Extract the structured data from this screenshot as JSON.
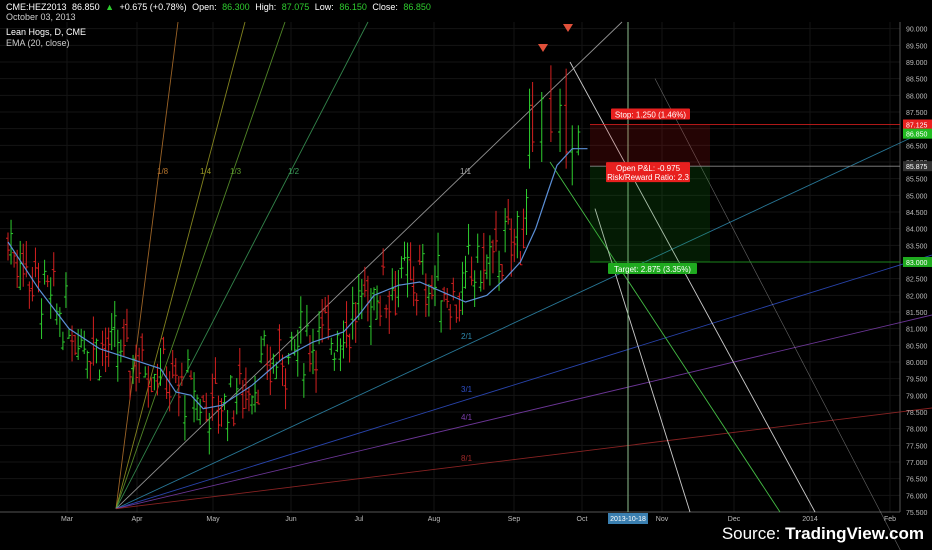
{
  "header": {
    "symbol": "CME:HEZ2013",
    "last": "86.850",
    "change": "+0.675 (+0.78%)",
    "open_label": "Open:",
    "open": "86.300",
    "high_label": "High:",
    "high": "87.075",
    "low_label": "Low:",
    "low": "86.150",
    "close_label": "Close:",
    "close": "86.850",
    "date": "October 03, 2013",
    "instrument": "Lean Hogs, D, CME",
    "indicator": "EMA (20, close)"
  },
  "source": {
    "prefix": "Source: ",
    "brand": "TradingView.com"
  },
  "colors": {
    "up": "#2ecc2e",
    "down": "#d42020",
    "ema": "#5b8fd6",
    "grid": "#141414",
    "stop": "#e8201f",
    "target": "#1faa1f",
    "crosshair": "#8fbf8f"
  },
  "chart_data": {
    "type": "candlestick",
    "y_axis": {
      "ylim": [
        75.5,
        90.2
      ],
      "ticks": [
        "75.500",
        "76.000",
        "76.500",
        "77.000",
        "77.500",
        "78.000",
        "78.500",
        "79.000",
        "79.500",
        "80.000",
        "80.500",
        "81.000",
        "81.500",
        "82.000",
        "82.500",
        "83.000",
        "83.500",
        "84.000",
        "84.500",
        "85.000",
        "85.500",
        "86.000",
        "86.500",
        "87.000",
        "87.500",
        "88.000",
        "88.500",
        "89.000",
        "89.500",
        "90.000"
      ],
      "highlight_labels": [
        {
          "text": "87.125",
          "value": 87.125,
          "color": "#e8201f"
        },
        {
          "text": "86.850",
          "value": 86.85,
          "color": "#22bb22"
        },
        {
          "text": "85.875",
          "value": 85.875,
          "color": "#333333"
        },
        {
          "text": "83.000",
          "value": 83.0,
          "color": "#1faa1f"
        }
      ]
    },
    "x_axis": {
      "labels": [
        "Mar",
        "Apr",
        "May",
        "Jun",
        "Jul",
        "Aug",
        "Sep",
        "Oct",
        "Nov",
        "Dec",
        "2014",
        "Feb"
      ],
      "cursor_label": "2013-10-18"
    },
    "fan_labels": [
      "1/8",
      "1/4",
      "1/3",
      "1/2",
      "1/1",
      "2/1",
      "3/1",
      "4/1",
      "8/1"
    ],
    "ema_points": [
      [
        0,
        83.6
      ],
      [
        10,
        82.2
      ],
      [
        20,
        81.0
      ],
      [
        30,
        80.4
      ],
      [
        40,
        80.1
      ],
      [
        50,
        79.8
      ],
      [
        55,
        79.1
      ],
      [
        60,
        79.0
      ],
      [
        64,
        78.6
      ],
      [
        70,
        78.7
      ],
      [
        80,
        79.3
      ],
      [
        90,
        80.1
      ],
      [
        100,
        80.6
      ],
      [
        110,
        80.9
      ],
      [
        115,
        81.4
      ],
      [
        120,
        82.0
      ],
      [
        128,
        82.3
      ],
      [
        135,
        82.4
      ],
      [
        140,
        82.2
      ],
      [
        145,
        82.0
      ],
      [
        150,
        81.8
      ],
      [
        157,
        82.0
      ],
      [
        163,
        82.5
      ],
      [
        168,
        83.0
      ],
      [
        173,
        84.0
      ],
      [
        177,
        85.1
      ],
      [
        180,
        85.9
      ],
      [
        185,
        86.4
      ],
      [
        190,
        86.4
      ]
    ],
    "extra_candles": [
      {
        "x": 171,
        "o": 86.2,
        "h": 88.2,
        "l": 85.8,
        "c": 87.7
      },
      {
        "x": 172,
        "o": 87.7,
        "h": 88.4,
        "l": 86.3,
        "c": 86.6
      },
      {
        "x": 175,
        "o": 86.6,
        "h": 88.1,
        "l": 86.0,
        "c": 87.9
      },
      {
        "x": 178,
        "o": 87.9,
        "h": 88.9,
        "l": 86.6,
        "c": 86.9
      },
      {
        "x": 181,
        "o": 86.9,
        "h": 88.2,
        "l": 86.3,
        "c": 87.7
      },
      {
        "x": 183,
        "o": 87.7,
        "h": 88.8,
        "l": 85.8,
        "c": 86.3
      },
      {
        "x": 185,
        "o": 86.3,
        "h": 87.1,
        "l": 85.3,
        "c": 86.4
      },
      {
        "x": 187,
        "o": 86.3,
        "h": 87.1,
        "l": 86.2,
        "c": 86.9
      }
    ],
    "series_ohlc_seed": "noise",
    "trade": {
      "entry": 85.875,
      "stop": 87.125,
      "target": 83.0,
      "stop_label": "Stop: 1.250 (1.46%)",
      "pnl_label": "Open P&L: -0.975",
      "rr_label": "Risk/Reward Ratio: 2.3",
      "target_label": "Target: 2.875 (3.35%)"
    }
  }
}
